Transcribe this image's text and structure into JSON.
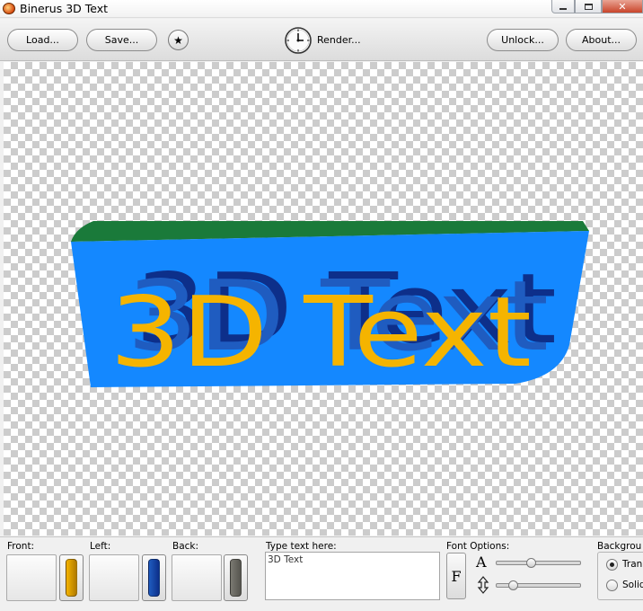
{
  "window": {
    "title": "Binerus 3D Text"
  },
  "toolbar": {
    "load_label": "Load...",
    "save_label": "Save...",
    "render_label": "Render...",
    "unlock_label": "Unlock...",
    "about_label": "About...",
    "star_icon": "star-icon",
    "clock_icon": "clock-icon"
  },
  "preview": {
    "text": "3D Text",
    "front_color": "#f5b400",
    "left_color": "#1f5cc0",
    "back_color": "#7b7a72",
    "panel_color": "#1488ff",
    "panel_edge_color": "#1a7a3a"
  },
  "panel": {
    "front_label": "Front:",
    "left_label": "Left:",
    "back_label": "Back:",
    "type_label": "Type text here:",
    "text_value": "3D Text",
    "font_options_label": "Font Options:",
    "font_button_label": "F",
    "size_icon_label": "A",
    "size_slider_level": 0.41,
    "depth_slider_level": 0.17,
    "background_label": "Backgrou",
    "bg_transparent_label": "Tran",
    "bg_solid_label": "Solid",
    "bg_selected": "transparent"
  }
}
